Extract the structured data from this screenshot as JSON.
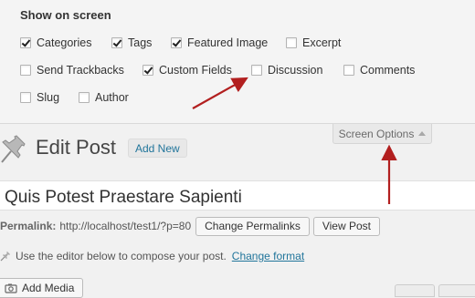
{
  "screen_options": {
    "heading": "Show on screen",
    "items": [
      {
        "label": "Categories",
        "checked": true
      },
      {
        "label": "Tags",
        "checked": true
      },
      {
        "label": "Featured Image",
        "checked": true
      },
      {
        "label": "Excerpt",
        "checked": false
      },
      {
        "label": "Send Trackbacks",
        "checked": false
      },
      {
        "label": "Custom Fields",
        "checked": true
      },
      {
        "label": "Discussion",
        "checked": false
      },
      {
        "label": "Comments",
        "checked": false
      },
      {
        "label": "Slug",
        "checked": false
      },
      {
        "label": "Author",
        "checked": false
      }
    ],
    "tab_label": "Screen Options"
  },
  "header": {
    "title": "Edit Post",
    "add_new": "Add New"
  },
  "post": {
    "title_value": "Quis Potest Praestare Sapienti",
    "permalink_label": "Permalink:",
    "permalink_url": "http://localhost/test1/?p=80",
    "change_permalinks": "Change Permalinks",
    "view_post": "View Post"
  },
  "editor": {
    "hint": "Use the editor below to compose your post.",
    "change_format": "Change format",
    "add_media": "Add Media"
  },
  "annotation_color": "#b21f1f"
}
